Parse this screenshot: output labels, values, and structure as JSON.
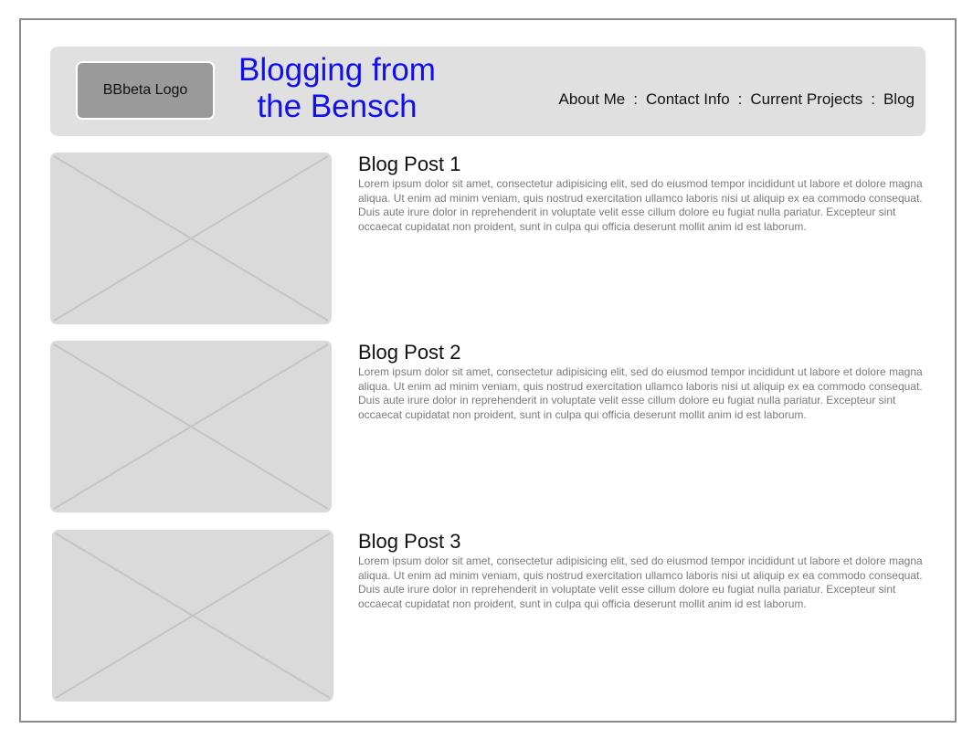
{
  "header": {
    "logo_label": "BBbeta Logo",
    "site_title": "Blogging from the Bensch",
    "nav": {
      "items": [
        "About Me",
        "Contact Info",
        "Current Projects",
        "Blog"
      ],
      "separator": ":"
    }
  },
  "posts": [
    {
      "title": "Blog Post 1",
      "body": "Lorem ipsum dolor sit amet, consectetur adipisicing elit, sed do eiusmod tempor incididunt ut labore et dolore magna aliqua. Ut enim ad minim veniam, quis nostrud exercitation ullamco laboris nisi ut aliquip ex ea commodo consequat. Duis aute irure dolor in reprehenderit in voluptate velit esse cillum dolore eu fugiat nulla pariatur. Excepteur sint occaecat cupidatat non proident, sunt in culpa qui officia deserunt mollit anim id est laborum."
    },
    {
      "title": "Blog Post 2",
      "body": "Lorem ipsum dolor sit amet, consectetur adipisicing elit, sed do eiusmod tempor incididunt ut labore et dolore magna aliqua. Ut enim ad minim veniam, quis nostrud exercitation ullamco laboris nisi ut aliquip ex ea commodo consequat. Duis aute irure dolor in reprehenderit in voluptate velit esse cillum dolore eu fugiat nulla pariatur. Excepteur sint occaecat cupidatat non proident, sunt in culpa qui officia deserunt mollit anim id est laborum."
    },
    {
      "title": "Blog Post 3",
      "body": "Lorem ipsum dolor sit amet, consectetur adipisicing elit, sed do eiusmod tempor incididunt ut labore et dolore magna aliqua. Ut enim ad minim veniam, quis nostrud exercitation ullamco laboris nisi ut aliquip ex ea commodo consequat. Duis aute irure dolor in reprehenderit in voluptate velit esse cillum dolore eu fugiat nulla pariatur. Excepteur sint occaecat cupidatat non proident, sunt in culpa qui officia deserunt mollit anim id est laborum."
    }
  ],
  "colors": {
    "title_blue": "#1010ee",
    "header_bg": "#e0e0e0",
    "logo_bg": "#9a9a9a",
    "placeholder_bg": "#dadada",
    "body_text": "#7a7a7a"
  },
  "icons": {
    "post_image": "image-placeholder-icon"
  }
}
